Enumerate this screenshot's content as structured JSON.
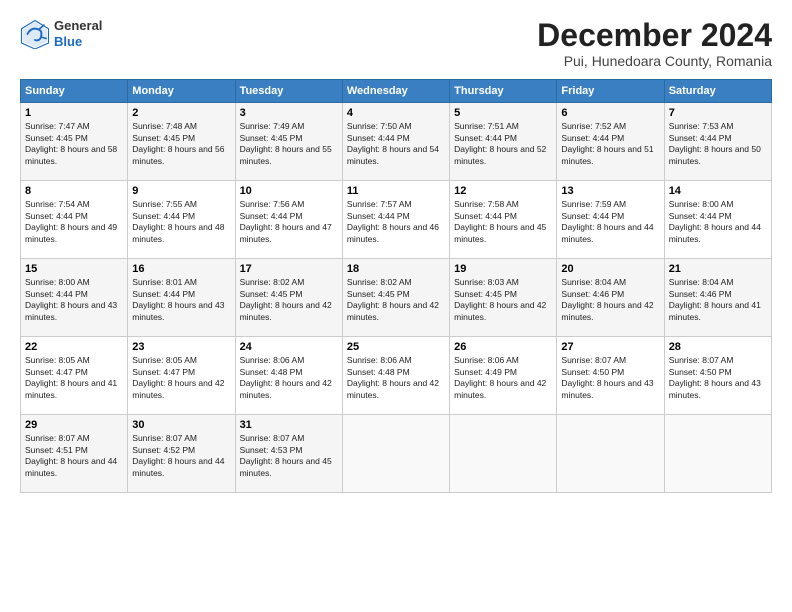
{
  "header": {
    "logo_general": "General",
    "logo_blue": "Blue",
    "title": "December 2024",
    "subtitle": "Pui, Hunedoara County, Romania"
  },
  "weekdays": [
    "Sunday",
    "Monday",
    "Tuesday",
    "Wednesday",
    "Thursday",
    "Friday",
    "Saturday"
  ],
  "weeks": [
    [
      {
        "day": "1",
        "sunrise": "Sunrise: 7:47 AM",
        "sunset": "Sunset: 4:45 PM",
        "daylight": "Daylight: 8 hours and 58 minutes."
      },
      {
        "day": "2",
        "sunrise": "Sunrise: 7:48 AM",
        "sunset": "Sunset: 4:45 PM",
        "daylight": "Daylight: 8 hours and 56 minutes."
      },
      {
        "day": "3",
        "sunrise": "Sunrise: 7:49 AM",
        "sunset": "Sunset: 4:45 PM",
        "daylight": "Daylight: 8 hours and 55 minutes."
      },
      {
        "day": "4",
        "sunrise": "Sunrise: 7:50 AM",
        "sunset": "Sunset: 4:44 PM",
        "daylight": "Daylight: 8 hours and 54 minutes."
      },
      {
        "day": "5",
        "sunrise": "Sunrise: 7:51 AM",
        "sunset": "Sunset: 4:44 PM",
        "daylight": "Daylight: 8 hours and 52 minutes."
      },
      {
        "day": "6",
        "sunrise": "Sunrise: 7:52 AM",
        "sunset": "Sunset: 4:44 PM",
        "daylight": "Daylight: 8 hours and 51 minutes."
      },
      {
        "day": "7",
        "sunrise": "Sunrise: 7:53 AM",
        "sunset": "Sunset: 4:44 PM",
        "daylight": "Daylight: 8 hours and 50 minutes."
      }
    ],
    [
      {
        "day": "8",
        "sunrise": "Sunrise: 7:54 AM",
        "sunset": "Sunset: 4:44 PM",
        "daylight": "Daylight: 8 hours and 49 minutes."
      },
      {
        "day": "9",
        "sunrise": "Sunrise: 7:55 AM",
        "sunset": "Sunset: 4:44 PM",
        "daylight": "Daylight: 8 hours and 48 minutes."
      },
      {
        "day": "10",
        "sunrise": "Sunrise: 7:56 AM",
        "sunset": "Sunset: 4:44 PM",
        "daylight": "Daylight: 8 hours and 47 minutes."
      },
      {
        "day": "11",
        "sunrise": "Sunrise: 7:57 AM",
        "sunset": "Sunset: 4:44 PM",
        "daylight": "Daylight: 8 hours and 46 minutes."
      },
      {
        "day": "12",
        "sunrise": "Sunrise: 7:58 AM",
        "sunset": "Sunset: 4:44 PM",
        "daylight": "Daylight: 8 hours and 45 minutes."
      },
      {
        "day": "13",
        "sunrise": "Sunrise: 7:59 AM",
        "sunset": "Sunset: 4:44 PM",
        "daylight": "Daylight: 8 hours and 44 minutes."
      },
      {
        "day": "14",
        "sunrise": "Sunrise: 8:00 AM",
        "sunset": "Sunset: 4:44 PM",
        "daylight": "Daylight: 8 hours and 44 minutes."
      }
    ],
    [
      {
        "day": "15",
        "sunrise": "Sunrise: 8:00 AM",
        "sunset": "Sunset: 4:44 PM",
        "daylight": "Daylight: 8 hours and 43 minutes."
      },
      {
        "day": "16",
        "sunrise": "Sunrise: 8:01 AM",
        "sunset": "Sunset: 4:44 PM",
        "daylight": "Daylight: 8 hours and 43 minutes."
      },
      {
        "day": "17",
        "sunrise": "Sunrise: 8:02 AM",
        "sunset": "Sunset: 4:45 PM",
        "daylight": "Daylight: 8 hours and 42 minutes."
      },
      {
        "day": "18",
        "sunrise": "Sunrise: 8:02 AM",
        "sunset": "Sunset: 4:45 PM",
        "daylight": "Daylight: 8 hours and 42 minutes."
      },
      {
        "day": "19",
        "sunrise": "Sunrise: 8:03 AM",
        "sunset": "Sunset: 4:45 PM",
        "daylight": "Daylight: 8 hours and 42 minutes."
      },
      {
        "day": "20",
        "sunrise": "Sunrise: 8:04 AM",
        "sunset": "Sunset: 4:46 PM",
        "daylight": "Daylight: 8 hours and 42 minutes."
      },
      {
        "day": "21",
        "sunrise": "Sunrise: 8:04 AM",
        "sunset": "Sunset: 4:46 PM",
        "daylight": "Daylight: 8 hours and 41 minutes."
      }
    ],
    [
      {
        "day": "22",
        "sunrise": "Sunrise: 8:05 AM",
        "sunset": "Sunset: 4:47 PM",
        "daylight": "Daylight: 8 hours and 41 minutes."
      },
      {
        "day": "23",
        "sunrise": "Sunrise: 8:05 AM",
        "sunset": "Sunset: 4:47 PM",
        "daylight": "Daylight: 8 hours and 42 minutes."
      },
      {
        "day": "24",
        "sunrise": "Sunrise: 8:06 AM",
        "sunset": "Sunset: 4:48 PM",
        "daylight": "Daylight: 8 hours and 42 minutes."
      },
      {
        "day": "25",
        "sunrise": "Sunrise: 8:06 AM",
        "sunset": "Sunset: 4:48 PM",
        "daylight": "Daylight: 8 hours and 42 minutes."
      },
      {
        "day": "26",
        "sunrise": "Sunrise: 8:06 AM",
        "sunset": "Sunset: 4:49 PM",
        "daylight": "Daylight: 8 hours and 42 minutes."
      },
      {
        "day": "27",
        "sunrise": "Sunrise: 8:07 AM",
        "sunset": "Sunset: 4:50 PM",
        "daylight": "Daylight: 8 hours and 43 minutes."
      },
      {
        "day": "28",
        "sunrise": "Sunrise: 8:07 AM",
        "sunset": "Sunset: 4:50 PM",
        "daylight": "Daylight: 8 hours and 43 minutes."
      }
    ],
    [
      {
        "day": "29",
        "sunrise": "Sunrise: 8:07 AM",
        "sunset": "Sunset: 4:51 PM",
        "daylight": "Daylight: 8 hours and 44 minutes."
      },
      {
        "day": "30",
        "sunrise": "Sunrise: 8:07 AM",
        "sunset": "Sunset: 4:52 PM",
        "daylight": "Daylight: 8 hours and 44 minutes."
      },
      {
        "day": "31",
        "sunrise": "Sunrise: 8:07 AM",
        "sunset": "Sunset: 4:53 PM",
        "daylight": "Daylight: 8 hours and 45 minutes."
      },
      null,
      null,
      null,
      null
    ]
  ]
}
